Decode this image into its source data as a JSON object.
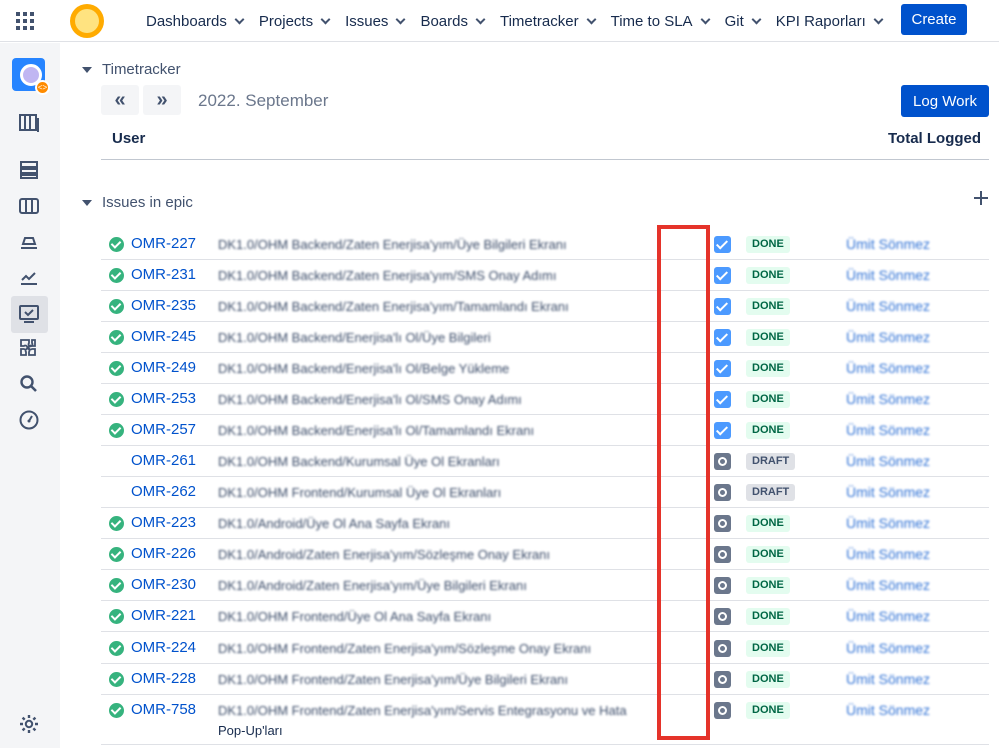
{
  "topnav": {
    "menu": [
      {
        "label": "Dashboards"
      },
      {
        "label": "Projects"
      },
      {
        "label": "Issues"
      },
      {
        "label": "Boards"
      },
      {
        "label": "Timetracker"
      },
      {
        "label": "Time to SLA"
      },
      {
        "label": "Git"
      },
      {
        "label": "KPI Raporları"
      }
    ],
    "create_label": "Create"
  },
  "timetracker": {
    "title": "Timetracker",
    "prev_label": "«",
    "next_label": "»",
    "month": "2022. September",
    "log_work_label": "Log Work",
    "col_user": "User",
    "col_total": "Total Logged"
  },
  "epic": {
    "title": "Issues in epic",
    "issues": [
      {
        "key": "OMR-227",
        "summary": "DK1.0/OHM Backend/Zaten Enerjisa'yım/Üye Bilgileri Ekranı",
        "status": "DONE"
      },
      {
        "key": "OMR-231",
        "summary": "DK1.0/OHM Backend/Zaten Enerjisa'yım/SMS Onay Adımı",
        "status": "DONE"
      },
      {
        "key": "OMR-235",
        "summary": "DK1.0/OHM Backend/Zaten Enerjisa'yım/Tamamlandı Ekranı",
        "status": "DONE"
      },
      {
        "key": "OMR-245",
        "summary": "DK1.0/OHM Backend/Enerjisa'lı Ol/Üye Bilgileri",
        "status": "DONE"
      },
      {
        "key": "OMR-249",
        "summary": "DK1.0/OHM Backend/Enerjisa'lı Ol/Belge Yükleme",
        "status": "DONE"
      },
      {
        "key": "OMR-253",
        "summary": "DK1.0/OHM Backend/Enerjisa'lı Ol/SMS Onay Adımı",
        "status": "DONE"
      },
      {
        "key": "OMR-257",
        "summary": "DK1.0/OHM Backend/Enerjisa'lı Ol/Tamamlandı Ekranı",
        "status": "DONE"
      },
      {
        "key": "OMR-261",
        "summary": "DK1.0/OHM Backend/Kurumsal Üye Ol Ekranları",
        "status": "DRAFT"
      },
      {
        "key": "OMR-262",
        "summary": "DK1.0/OHM Frontend/Kurumsal Üye Ol Ekranları",
        "status": "DRAFT"
      },
      {
        "key": "OMR-223",
        "summary": "DK1.0/Android/Üye Ol Ana Sayfa Ekranı",
        "status": "DONE"
      },
      {
        "key": "OMR-226",
        "summary": "DK1.0/Android/Zaten Enerjisa'yım/Sözleşme Onay Ekranı",
        "status": "DONE"
      },
      {
        "key": "OMR-230",
        "summary": "DK1.0/Android/Zaten Enerjisa'yım/Üye Bilgileri Ekranı",
        "status": "DONE"
      },
      {
        "key": "OMR-221",
        "summary": "DK1.0/OHM Frontend/Üye Ol Ana Sayfa Ekranı",
        "status": "DONE"
      },
      {
        "key": "OMR-224",
        "summary": "DK1.0/OHM Frontend/Zaten Enerjisa'yım/Sözleşme Onay Ekranı",
        "status": "DONE"
      },
      {
        "key": "OMR-228",
        "summary": "DK1.0/OHM Frontend/Zaten Enerjisa'yım/Üye Bilgileri Ekranı",
        "status": "DONE"
      },
      {
        "key": "OMR-758",
        "summary": "DK1.0/OHM Frontend/Zaten Enerjisa'yım/Servis Entegrasyonu ve Hata",
        "summary_cont": "Pop-Up'ları",
        "status": "DONE"
      }
    ]
  },
  "assignee": "Ümit Sönmez",
  "colors": {
    "accent": "#0052cc",
    "done_bg": "#e3fcef",
    "done_text": "#006644",
    "highlight": "#e5332a"
  }
}
